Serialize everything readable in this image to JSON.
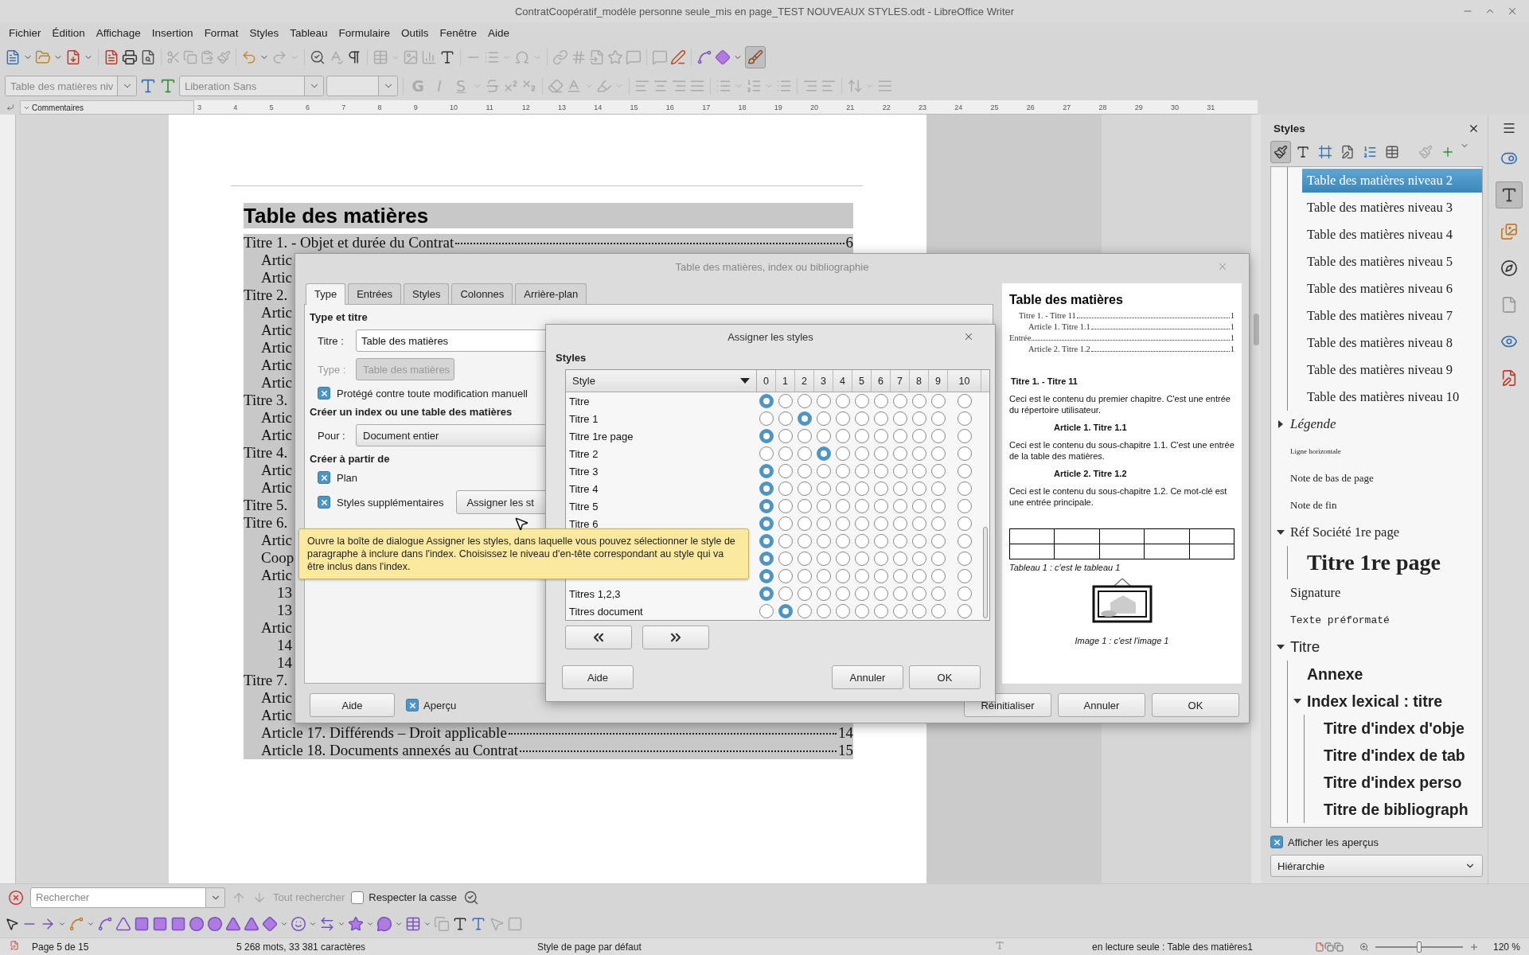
{
  "window": {
    "title": "ContratCoopératif_modèle personne seule_mis en page_TEST NOUVEAUX STYLES.odt - LibreOffice Writer"
  },
  "menu": [
    "Fichier",
    "Édition",
    "Affichage",
    "Insertion",
    "Format",
    "Styles",
    "Tableau",
    "Formulaire",
    "Outils",
    "Fenêtre",
    "Aide"
  ],
  "formatting_bar": {
    "paragraph_style": "Table des matières niv",
    "font_name": "Liberation Sans",
    "glyph_buttons": [
      {
        "glyph": "G",
        "kind": "bold"
      },
      {
        "glyph": "I",
        "kind": "italic"
      },
      {
        "glyph": "S",
        "kind": "underline"
      }
    ]
  },
  "ruler": {
    "comments_label": "Commentaires",
    "marks": [
      "3",
      "4",
      "5",
      "6",
      "7",
      "8",
      "9",
      "10",
      "11",
      "12",
      "13",
      "14",
      "15",
      "16",
      "17",
      "18",
      "19",
      "20",
      "21",
      "22",
      "23",
      "24",
      "25",
      "26",
      "27",
      "28",
      "29",
      "30",
      "31"
    ]
  },
  "document": {
    "heading": "Table des matières",
    "toc": [
      {
        "text": "Titre 1. - Objet et durée du Contrat",
        "page": "6",
        "children": [
          {
            "text": "Artic"
          },
          {
            "text": "Artic"
          }
        ]
      },
      {
        "text": "Titre 2.",
        "children": [
          {
            "text": "Artic"
          },
          {
            "text": "Artic"
          },
          {
            "text": "Artic"
          },
          {
            "text": "Artic"
          },
          {
            "text": "Artic"
          }
        ]
      },
      {
        "text": "Titre 3.",
        "children": [
          {
            "text": "Artic"
          },
          {
            "text": "Artic"
          }
        ]
      },
      {
        "text": "Titre 4.",
        "children": [
          {
            "text": "Artic"
          },
          {
            "text": "Artic"
          }
        ]
      },
      {
        "text": "Titre 5."
      },
      {
        "text": "Titre 6.",
        "children": [
          {
            "text": "Artic"
          },
          {
            "text": "Coop"
          },
          {
            "text": "Artic",
            "children": [
              {
                "text": "13"
              },
              {
                "text": "13"
              }
            ]
          },
          {
            "text": "Artic",
            "children": [
              {
                "text": "14"
              },
              {
                "text": "14"
              }
            ]
          }
        ]
      },
      {
        "text": "Titre 7.",
        "children": [
          {
            "text": "Artic"
          },
          {
            "text": "Artic"
          },
          {
            "text": "Article 17. Différends – Droit applicable",
            "page": "14"
          },
          {
            "text": "Article 18. Documents annexés au Contrat",
            "page": "15"
          }
        ]
      }
    ]
  },
  "toc_dialog": {
    "title": "Table des matières, index ou bibliographie",
    "tabs": [
      {
        "label": "Type",
        "selected": true
      },
      {
        "label": "Entrées",
        "selected": false
      },
      {
        "label": "Styles",
        "selected": false
      },
      {
        "label": "Colonnes",
        "selected": false
      },
      {
        "label": "Arrière-plan",
        "selected": false
      }
    ],
    "type_section": "Type et titre",
    "title_label": "Titre :",
    "title_value": "Table des matières",
    "type_label": "Type :",
    "type_value": "Table des matières",
    "type_disabled": true,
    "protected": {
      "label": "Protégé contre toute modification manuell",
      "checked": true
    },
    "create_section": "Créer un index ou une table des matières",
    "for_label": "Pour :",
    "for_value": "Document entier",
    "from_section": "Créer à partir de",
    "outline": {
      "label": "Plan",
      "checked": true
    },
    "additional_styles": {
      "label": "Styles supplémentaires",
      "checked": true
    },
    "assign_button": "Assigner les st",
    "help": "Aide",
    "preview_toggle": {
      "label": "Aperçu",
      "checked": true
    },
    "buttons": [
      "Réinitialiser",
      "Annuler",
      "OK"
    ],
    "preview": {
      "heading": "Table des matières",
      "toc": [
        {
          "text": "Titre 1. - Titre 11",
          "page": "1",
          "kind": "level1"
        },
        {
          "text": "Article 1. Titre 1.1",
          "page": "1",
          "kind": "level2"
        },
        {
          "text": "Entrée",
          "page": "1",
          "kind": "entry"
        },
        {
          "text": "Article 2. Titre 1.2",
          "page": "1",
          "kind": "level2"
        }
      ],
      "body": [
        {
          "kind": "title",
          "text": "Titre 1. - Titre 11"
        },
        {
          "kind": "para",
          "text": "Ceci est le contenu du premier chapitre. C'est une entrée du répertoire utilisateur."
        },
        {
          "kind": "subtitle",
          "text": "Article 1. Titre 1.1"
        },
        {
          "kind": "para",
          "text": "Ceci est le contenu du sous-chapitre 1.1. C'est une entrée de la table des matières."
        },
        {
          "kind": "subtitle",
          "text": "Article 2. Titre 1.2"
        },
        {
          "kind": "para",
          "text": "Ceci est le contenu du sous-chapitre 1.2. Ce mot-clé est une entrée principale."
        }
      ],
      "table_caption": "Tableau 1 : c'est le tableau 1",
      "image_caption": "Image 1 : c'est l'image 1"
    }
  },
  "assign_dialog": {
    "title": "Assigner les styles",
    "section": "Styles",
    "style_header": "Style",
    "columns": [
      "0",
      "1",
      "2",
      "3",
      "4",
      "5",
      "6",
      "7",
      "8",
      "9",
      "10"
    ],
    "rows": [
      {
        "name": "Titre",
        "choices": [
          {
            "selected": true
          },
          {
            "selected": false
          },
          {
            "selected": false
          },
          {
            "selected": false
          },
          {
            "selected": false
          },
          {
            "selected": false
          },
          {
            "selected": false
          },
          {
            "selected": false
          },
          {
            "selected": false
          },
          {
            "selected": false
          },
          {
            "selected": false
          }
        ]
      },
      {
        "name": "Titre 1",
        "choices": [
          {
            "selected": false
          },
          {
            "selected": false
          },
          {
            "selected": true
          },
          {
            "selected": false
          },
          {
            "selected": false
          },
          {
            "selected": false
          },
          {
            "selected": false
          },
          {
            "selected": false
          },
          {
            "selected": false
          },
          {
            "selected": false
          },
          {
            "selected": false
          }
        ]
      },
      {
        "name": "Titre 1re page",
        "choices": [
          {
            "selected": true
          },
          {
            "selected": false
          },
          {
            "selected": false
          },
          {
            "selected": false
          },
          {
            "selected": false
          },
          {
            "selected": false
          },
          {
            "selected": false
          },
          {
            "selected": false
          },
          {
            "selected": false
          },
          {
            "selected": false
          },
          {
            "selected": false
          }
        ]
      },
      {
        "name": "Titre 2",
        "choices": [
          {
            "selected": false
          },
          {
            "selected": false
          },
          {
            "selected": false
          },
          {
            "selected": true
          },
          {
            "selected": false
          },
          {
            "selected": false
          },
          {
            "selected": false
          },
          {
            "selected": false
          },
          {
            "selected": false
          },
          {
            "selected": false
          },
          {
            "selected": false
          }
        ]
      },
      {
        "name": "Titre 3",
        "choices": [
          {
            "selected": true
          },
          {
            "selected": false
          },
          {
            "selected": false
          },
          {
            "selected": false
          },
          {
            "selected": false
          },
          {
            "selected": false
          },
          {
            "selected": false
          },
          {
            "selected": false
          },
          {
            "selected": false
          },
          {
            "selected": false
          },
          {
            "selected": false
          }
        ]
      },
      {
        "name": "Titre 4",
        "choices": [
          {
            "selected": true
          },
          {
            "selected": false
          },
          {
            "selected": false
          },
          {
            "selected": false
          },
          {
            "selected": false
          },
          {
            "selected": false
          },
          {
            "selected": false
          },
          {
            "selected": false
          },
          {
            "selected": false
          },
          {
            "selected": false
          },
          {
            "selected": false
          }
        ]
      },
      {
        "name": "Titre 5",
        "choices": [
          {
            "selected": true
          },
          {
            "selected": false
          },
          {
            "selected": false
          },
          {
            "selected": false
          },
          {
            "selected": false
          },
          {
            "selected": false
          },
          {
            "selected": false
          },
          {
            "selected": false
          },
          {
            "selected": false
          },
          {
            "selected": false
          },
          {
            "selected": false
          }
        ]
      },
      {
        "name": "Titre 6",
        "choices": [
          {
            "selected": true
          },
          {
            "selected": false
          },
          {
            "selected": false
          },
          {
            "selected": false
          },
          {
            "selected": false
          },
          {
            "selected": false
          },
          {
            "selected": false
          },
          {
            "selected": false
          },
          {
            "selected": false
          },
          {
            "selected": false
          },
          {
            "selected": false
          }
        ]
      },
      {
        "choices": [
          {
            "selected": true
          },
          {
            "selected": false
          },
          {
            "selected": false
          },
          {
            "selected": false
          },
          {
            "selected": false
          },
          {
            "selected": false
          },
          {
            "selected": false
          },
          {
            "selected": false
          },
          {
            "selected": false
          },
          {
            "selected": false
          },
          {
            "selected": false
          }
        ]
      },
      {
        "choices": [
          {
            "selected": true
          },
          {
            "selected": false
          },
          {
            "selected": false
          },
          {
            "selected": false
          },
          {
            "selected": false
          },
          {
            "selected": false
          },
          {
            "selected": false
          },
          {
            "selected": false
          },
          {
            "selected": false
          },
          {
            "selected": false
          },
          {
            "selected": false
          }
        ]
      },
      {
        "choices": [
          {
            "selected": true
          },
          {
            "selected": false
          },
          {
            "selected": false
          },
          {
            "selected": false
          },
          {
            "selected": false
          },
          {
            "selected": false
          },
          {
            "selected": false
          },
          {
            "selected": false
          },
          {
            "selected": false
          },
          {
            "selected": false
          },
          {
            "selected": false
          }
        ]
      },
      {
        "name": "Titres 1,2,3",
        "choices": [
          {
            "selected": true
          },
          {
            "selected": false
          },
          {
            "selected": false
          },
          {
            "selected": false
          },
          {
            "selected": false
          },
          {
            "selected": false
          },
          {
            "selected": false
          },
          {
            "selected": false
          },
          {
            "selected": false
          },
          {
            "selected": false
          },
          {
            "selected": false
          }
        ]
      },
      {
        "name": "Titres document",
        "choices": [
          {
            "selected": false
          },
          {
            "selected": true
          },
          {
            "selected": false
          },
          {
            "selected": false
          },
          {
            "selected": false
          },
          {
            "selected": false
          },
          {
            "selected": false
          },
          {
            "selected": false
          },
          {
            "selected": false
          },
          {
            "selected": false
          },
          {
            "selected": false
          }
        ]
      }
    ],
    "buttons": [
      "Aide",
      "Annuler",
      "OK"
    ]
  },
  "tooltip": "Ouvre la boîte de dialogue Assigner les styles, dans laquelle vous pouvez sélectionner le style de paragraphe à inclure dans l'index. Choisissez le niveau d'en-tête correspondant au style qui va être inclus dans l'index.",
  "styles_panel": {
    "title": "Styles",
    "tree": [
      {
        "children": [
          {
            "label": "Table des matières niveau 2",
            "kind": "serif",
            "selected": true
          },
          {
            "label": "Table des matières niveau 3",
            "kind": "serif",
            "selected": false
          },
          {
            "label": "Table des matières niveau 4",
            "kind": "serif",
            "selected": false
          },
          {
            "label": "Table des matières niveau 5",
            "kind": "serif",
            "selected": false
          },
          {
            "label": "Table des matières niveau 6",
            "kind": "serif",
            "selected": false
          },
          {
            "label": "Table des matières niveau 7",
            "kind": "serif",
            "selected": false
          },
          {
            "label": "Table des matières niveau 8",
            "kind": "serif",
            "selected": false
          },
          {
            "label": "Table des matières niveau 9",
            "kind": "serif",
            "selected": false
          },
          {
            "label": "Table des matières niveau 10",
            "kind": "serif",
            "selected": false
          }
        ]
      },
      {
        "label": "Légende",
        "kind": "italic",
        "expanded": false,
        "selected": false
      },
      {
        "label": "Ligne horizontale",
        "kind": "tiny",
        "selected": false
      },
      {
        "label": "Note de bas de page",
        "kind": "small",
        "selected": false
      },
      {
        "label": "Note de fin",
        "kind": "small",
        "selected": false
      },
      {
        "label": "Réf Société 1re page",
        "kind": "serif",
        "expanded": true,
        "selected": false,
        "children": [
          {
            "label": "Titre 1re page",
            "kind": "display",
            "selected": false
          }
        ]
      },
      {
        "label": "Signature",
        "kind": "serif",
        "selected": false
      },
      {
        "label": "Texte préformaté",
        "kind": "mono",
        "selected": false
      },
      {
        "label": "Titre",
        "kind": "sans",
        "expanded": true,
        "selected": false,
        "children": [
          {
            "label": "Annexe",
            "kind": "sans-bold",
            "selected": false
          },
          {
            "label": "Index lexical : titre",
            "kind": "sans-bold",
            "expanded": true,
            "selected": false,
            "children": [
              {
                "label": "Titre d'index d'obje",
                "kind": "sans-bold",
                "selected": false
              },
              {
                "label": "Titre d'index de tab",
                "kind": "sans-bold",
                "selected": false
              },
              {
                "label": "Titre d'index perso",
                "kind": "sans-bold",
                "selected": false
              },
              {
                "label": "Titre de bibliograph",
                "kind": "sans-bold",
                "selected": false
              }
            ]
          }
        ]
      }
    ],
    "show_previews": {
      "label": "Afficher les aperçus",
      "checked": true
    },
    "filter": "Hiérarchie"
  },
  "find_bar": {
    "placeholder": "Rechercher",
    "find_all": "Tout rechercher",
    "find_all_disabled": true,
    "match_case": {
      "label": "Respecter la casse",
      "checked": false
    }
  },
  "status_bar": {
    "page": "Page 5 de 15",
    "words": "5 268 mots, 33 381 caractères",
    "page_style": "Style de page par défaut",
    "mode": "en lecture seule : Table des matières1",
    "zoom": {
      "level": 0.5,
      "reading": "120 %"
    }
  }
}
